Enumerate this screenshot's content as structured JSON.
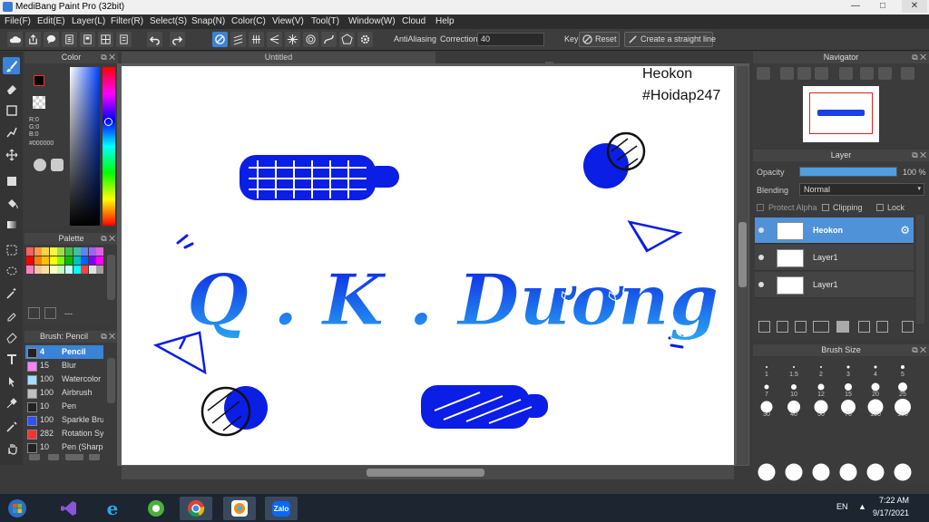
{
  "title_bar": {
    "title": "MediBang Paint Pro (32bit)"
  },
  "menu": [
    "File(F)",
    "Edit(E)",
    "Layer(L)",
    "Filter(R)",
    "Select(S)",
    "Snap(N)",
    "Color(C)",
    "View(V)",
    "Tool(T)",
    "Window(W)",
    "Cloud",
    "Help"
  ],
  "toolbar": {
    "antialiasing_label": "AntiAliasing",
    "correction_label": "Correction",
    "correction_value": "40",
    "key_label": "Key",
    "reset_label": "Reset",
    "straight_line_label": "Create a straight line"
  },
  "color_panel": {
    "title": "Color",
    "r": "R:0",
    "g": "G:0",
    "b": "B:0",
    "hex": "#000000"
  },
  "palette_panel": {
    "title": "Palette",
    "footer": "---",
    "swatches": [
      "#ff6060",
      "#ff9a40",
      "#ffd040",
      "#f8f840",
      "#a0e040",
      "#40c040",
      "#40c0a0",
      "#6080ff",
      "#a060ff",
      "#e060e0",
      "#ff0000",
      "#ff8000",
      "#ffc000",
      "#ffff00",
      "#80ff00",
      "#00c000",
      "#00c0c0",
      "#0060ff",
      "#8000ff",
      "#ff00ff",
      "#ff80c0",
      "#ffc0a0",
      "#ffe0a0",
      "#ffffc0",
      "#c0ffc0",
      "#c0ffff",
      "#00ffff",
      "#ff4040",
      "#e0e0e0",
      "#a0a0a0"
    ]
  },
  "brush_panel": {
    "title": "Brush: Pencil",
    "items": [
      {
        "size": "4",
        "name": "Pencil",
        "color": "#222222"
      },
      {
        "size": "15",
        "name": "Blur",
        "color": "#ff80ff"
      },
      {
        "size": "100",
        "name": "Watercolor",
        "color": "#9fe0ff"
      },
      {
        "size": "100",
        "name": "Airbrush",
        "color": "#c0c0c0"
      },
      {
        "size": "10",
        "name": "Pen",
        "color": "#222222"
      },
      {
        "size": "100",
        "name": "Sparkle Brush",
        "color": "#3050ff"
      },
      {
        "size": "282",
        "name": "Rotation Symmetry",
        "color": "#ff3030"
      },
      {
        "size": "10",
        "name": "Pen (Sharp)",
        "color": "#222222"
      }
    ]
  },
  "canvas": {
    "tab_title": "Untitled",
    "signature_line1": "Heokon",
    "signature_line2": "#Hoidap247",
    "lettering": "Q . K . Dương",
    "blue_color": "#0a1ee6"
  },
  "navigator": {
    "title": "Navigator"
  },
  "layer_panel": {
    "title": "Layer",
    "opacity_label": "Opacity",
    "opacity_value": "100 %",
    "opacity_fraction": 1.0,
    "blending_label": "Blending",
    "blending_value": "Normal",
    "protect_alpha_label": "Protect Alpha",
    "clipping_label": "Clipping",
    "lock_label": "Lock",
    "layers": [
      {
        "name": "Heokon",
        "selected": true
      },
      {
        "name": "Layer1",
        "selected": false
      },
      {
        "name": "Layer1",
        "selected": false
      }
    ]
  },
  "brush_size_panel": {
    "title": "Brush Size",
    "sizes": [
      "1",
      "1.5",
      "2",
      "3",
      "4",
      "5",
      "7",
      "10",
      "12",
      "15",
      "20",
      "25",
      "30",
      "40",
      "50",
      "70",
      "100",
      "150"
    ]
  },
  "taskbar": {
    "lang": "EN",
    "time": "7:22 AM",
    "date": "9/17/2021",
    "zalo_label": "Zalo"
  }
}
